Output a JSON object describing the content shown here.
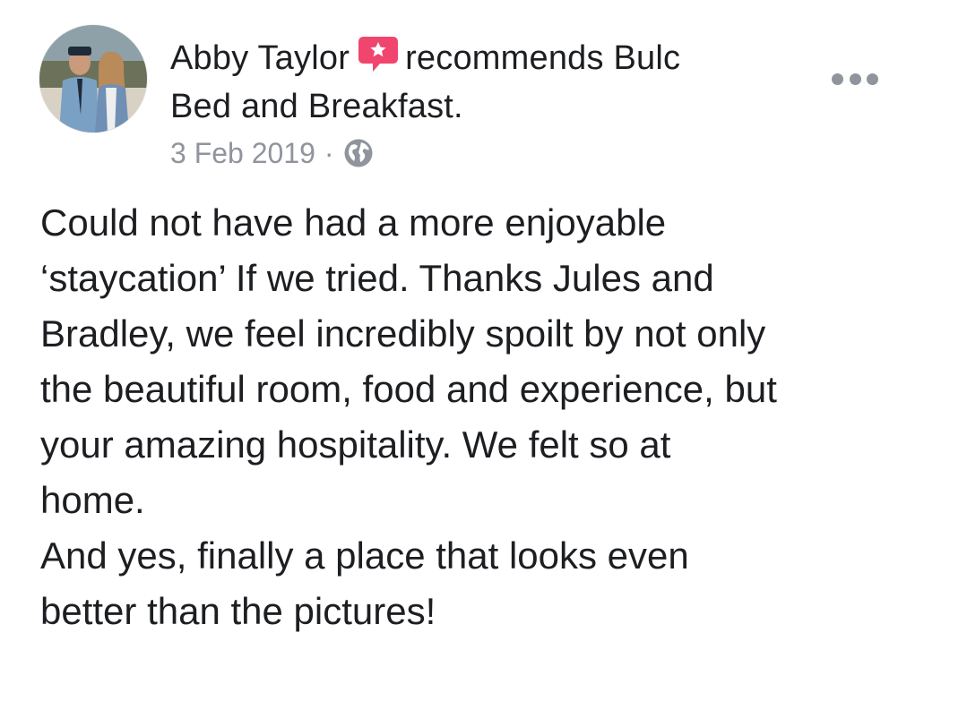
{
  "post": {
    "author": "Abby Taylor",
    "action": "recommends Bulc Bed and Breakfast.",
    "date": "3 Feb 2019",
    "separator": "·",
    "privacy_icon": "globe-icon",
    "recommend_icon": "star-speech-bubble-icon",
    "more_icon": "ellipsis-icon",
    "body": "Could not have had a more enjoyable\n‘staycation’ If we tried. Thanks Jules and\nBradley, we feel incredibly spoilt by not only\nthe beautiful room, food and experience, but\nyour amazing hospitality. We felt so at\nhome.\nAnd yes, finally a place that looks even\nbetter than the pictures!"
  },
  "colors": {
    "text": "#1c1e21",
    "meta": "#90949c",
    "recommend_red": "#f0466e"
  }
}
